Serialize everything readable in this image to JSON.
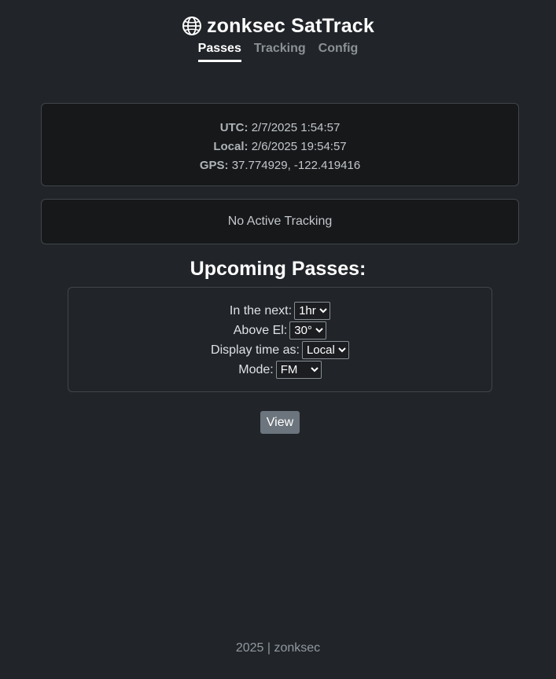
{
  "app": {
    "title": "zonksec SatTrack",
    "icon": "globe-icon"
  },
  "nav": {
    "tabs": [
      {
        "label": "Passes",
        "active": true
      },
      {
        "label": "Tracking",
        "active": false
      },
      {
        "label": "Config",
        "active": false
      }
    ]
  },
  "time": {
    "utc_label": "UTC:",
    "utc_value": "2/7/2025 1:54:57",
    "local_label": "Local:",
    "local_value": "2/6/2025 19:54:57",
    "gps_label": "GPS:",
    "gps_value": "37.774929, -122.419416"
  },
  "tracking": {
    "status": "No Active Tracking"
  },
  "passes": {
    "heading": "Upcoming Passes:",
    "next_label": "In the next:",
    "next_value": "1hr",
    "el_label": "Above El:",
    "el_value": "30°",
    "display_label": "Display time as:",
    "display_value": "Local",
    "mode_label": "Mode:",
    "mode_value": "FM",
    "view_button": "View"
  },
  "footer": {
    "text": "2025 | zonksec"
  },
  "colors": {
    "background": "#212529",
    "card": "#161819",
    "button": "#6c757d",
    "border": "#41464c"
  }
}
